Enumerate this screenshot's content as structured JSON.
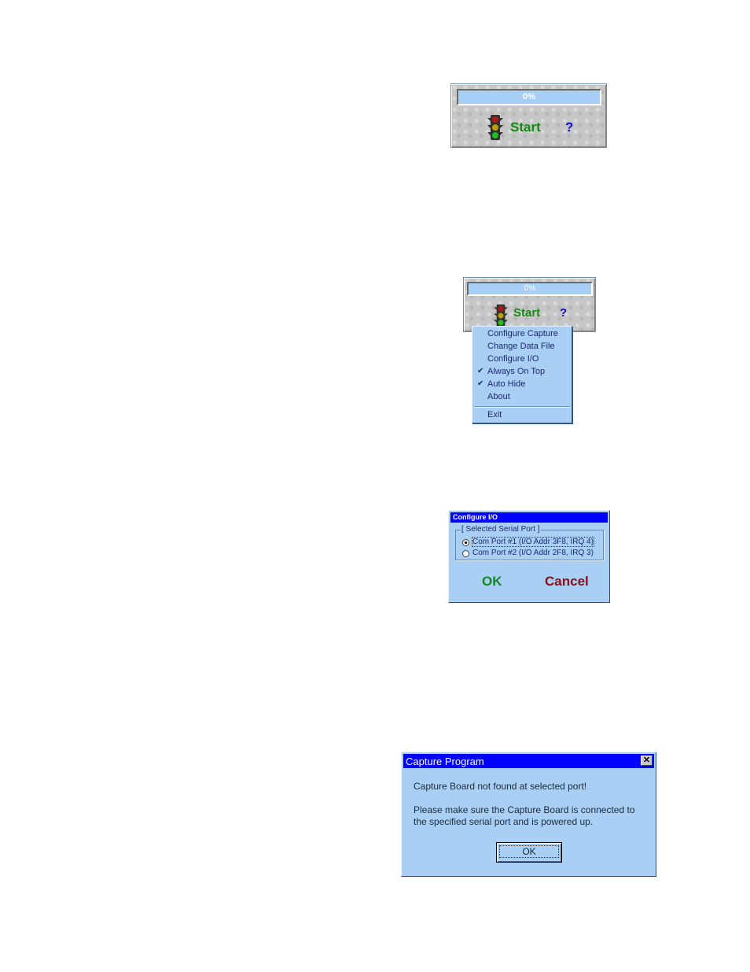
{
  "widget1": {
    "progress_text": "0%",
    "start_label": "Start",
    "help_label": "?"
  },
  "widget2": {
    "progress_text": "0%",
    "start_label": "Start",
    "help_label": "?"
  },
  "context_menu": {
    "items": [
      {
        "label": "Configure Capture",
        "checked": false
      },
      {
        "label": "Change Data File",
        "checked": false
      },
      {
        "label": "Configure I/O",
        "checked": false
      },
      {
        "label": "Always On Top",
        "checked": true
      },
      {
        "label": "Auto Hide",
        "checked": true
      },
      {
        "label": "About",
        "checked": false
      }
    ],
    "exit_label": "Exit",
    "check_glyph": "✔"
  },
  "configure_io": {
    "title": "Configure I/O",
    "group_label": "[ Selected Serial Port ]",
    "options": [
      {
        "label": "Com Port #1 (I/O Addr 3F8, IRQ 4)",
        "selected": true
      },
      {
        "label": "Com Port #2 (I/O Addr 2F8, IRQ 3)",
        "selected": false
      }
    ],
    "ok_label": "OK",
    "cancel_label": "Cancel"
  },
  "capture_dialog": {
    "title": "Capture Program",
    "close_glyph": "✕",
    "message1": "Capture Board not found at selected port!",
    "message2_line1": "Please make sure the Capture Board is connected to",
    "message2_line2": "the specified serial port and is powered up.",
    "ok_label": "OK"
  },
  "colors": {
    "dialog_bg": "#a9cff5",
    "titlebar": "#0000ff",
    "start_green": "#138a13",
    "cancel_red": "#8b0c14",
    "help_blue": "#1010c8"
  }
}
